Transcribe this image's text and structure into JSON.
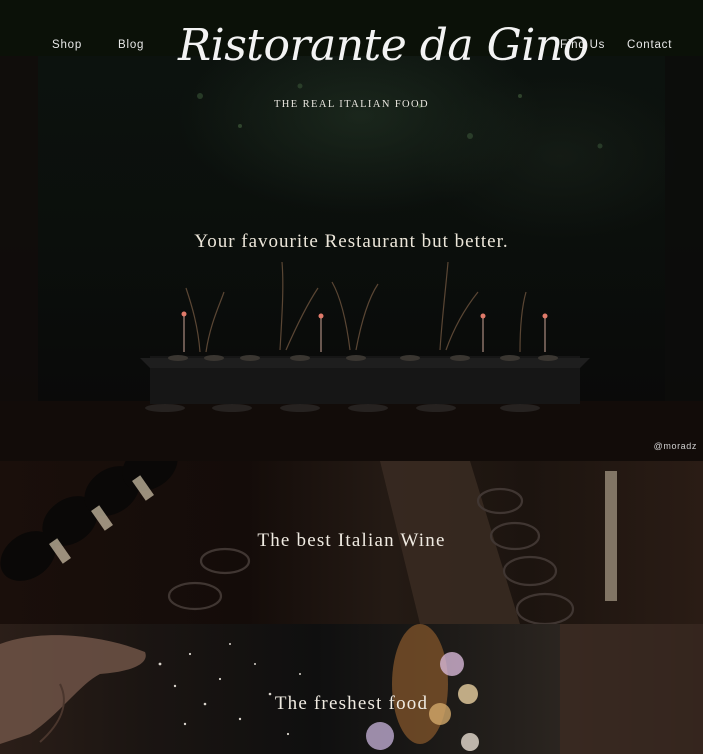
{
  "nav": {
    "left": [
      {
        "label": "Shop"
      },
      {
        "label": "Blog"
      }
    ],
    "right": [
      {
        "label": "Find Us"
      },
      {
        "label": "Contact"
      }
    ]
  },
  "brand": {
    "logo_text": "Ristorante da Gino",
    "tagline": "THE REAL ITALIAN FOOD"
  },
  "hero": {
    "headline": "Your favourite Restaurant but better.",
    "credit": "@moradz"
  },
  "sections": [
    {
      "headline": "The best Italian Wine"
    },
    {
      "headline": "The freshest food"
    }
  ],
  "colors": {
    "header_bg": "#0b1108",
    "text": "#ece6da",
    "candle": "#e07a6a"
  }
}
